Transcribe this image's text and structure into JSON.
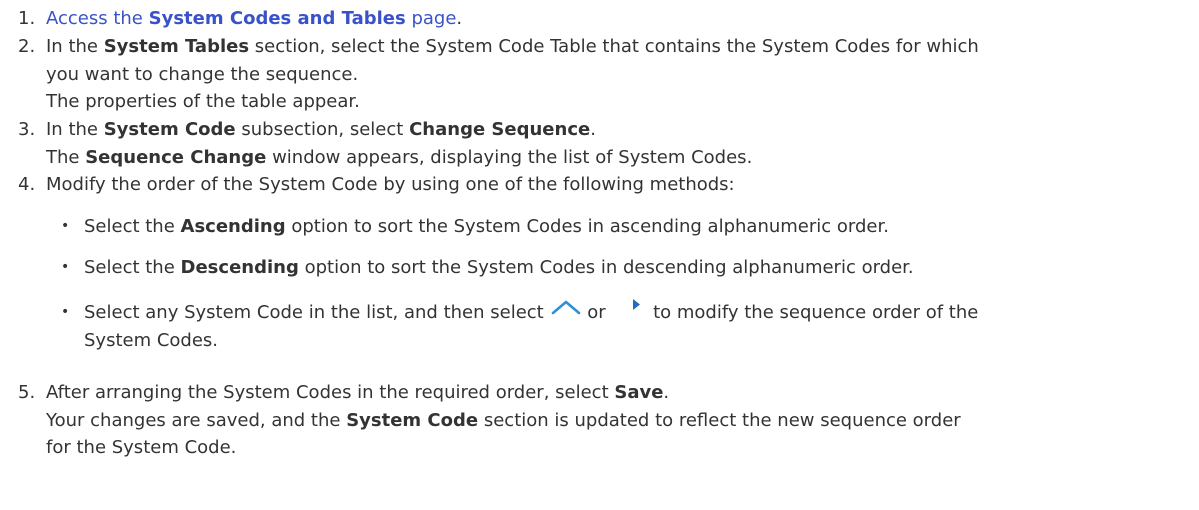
{
  "steps": [
    {
      "number": "1.",
      "link_text": "Access the",
      "link_bold": "System Codes and Tables",
      "link_after": "page",
      "after": "."
    },
    {
      "number": "2.",
      "pre": "In the",
      "bold1": "System Tables",
      "post1": "section, select the System Code Table that contains the System Codes for which",
      "line2": "you want to change the sequence.",
      "line3": "The properties of the table appear."
    },
    {
      "number": "3.",
      "pre": "In the",
      "bold1": "System Code",
      "mid": "subsection, select",
      "bold2": "Change Sequence",
      "end": ".",
      "l2_pre": "The",
      "l2_bold": "Sequence Change",
      "l2_post": "window appears, displaying the list of System Codes."
    },
    {
      "number": "4.",
      "text": "Modify the order of the System Code by using one of the following methods:",
      "bullets": [
        {
          "dot": "•",
          "pre": "Select the",
          "bold": "Ascending",
          "post": "option to sort the System Codes in ascending alphanumeric order."
        },
        {
          "dot": "•",
          "pre": "Select the",
          "bold": "Descending",
          "post": "option to sort the System Codes in descending alphanumeric order."
        },
        {
          "dot": "•",
          "pre": "Select any System Code in the list, and then select",
          "or": "or",
          "post": "to modify the sequence order of the",
          "line2": "System Codes.",
          "up_icon": "chevron-up-icon",
          "right_icon": "triangle-right-icon"
        }
      ]
    },
    {
      "number": "5.",
      "pre": "After arranging the System Codes in the required order, select",
      "bold1": "Save",
      "end": ".",
      "l2_pre": "Your changes are saved, and the",
      "l2_bold": "System Code",
      "l2_post": "section is updated to reflect the new sequence order",
      "line3": "for the System Code."
    }
  ],
  "colors": {
    "text": "#333333",
    "link": "#3a52c9",
    "icon": "#2f8fd6"
  }
}
